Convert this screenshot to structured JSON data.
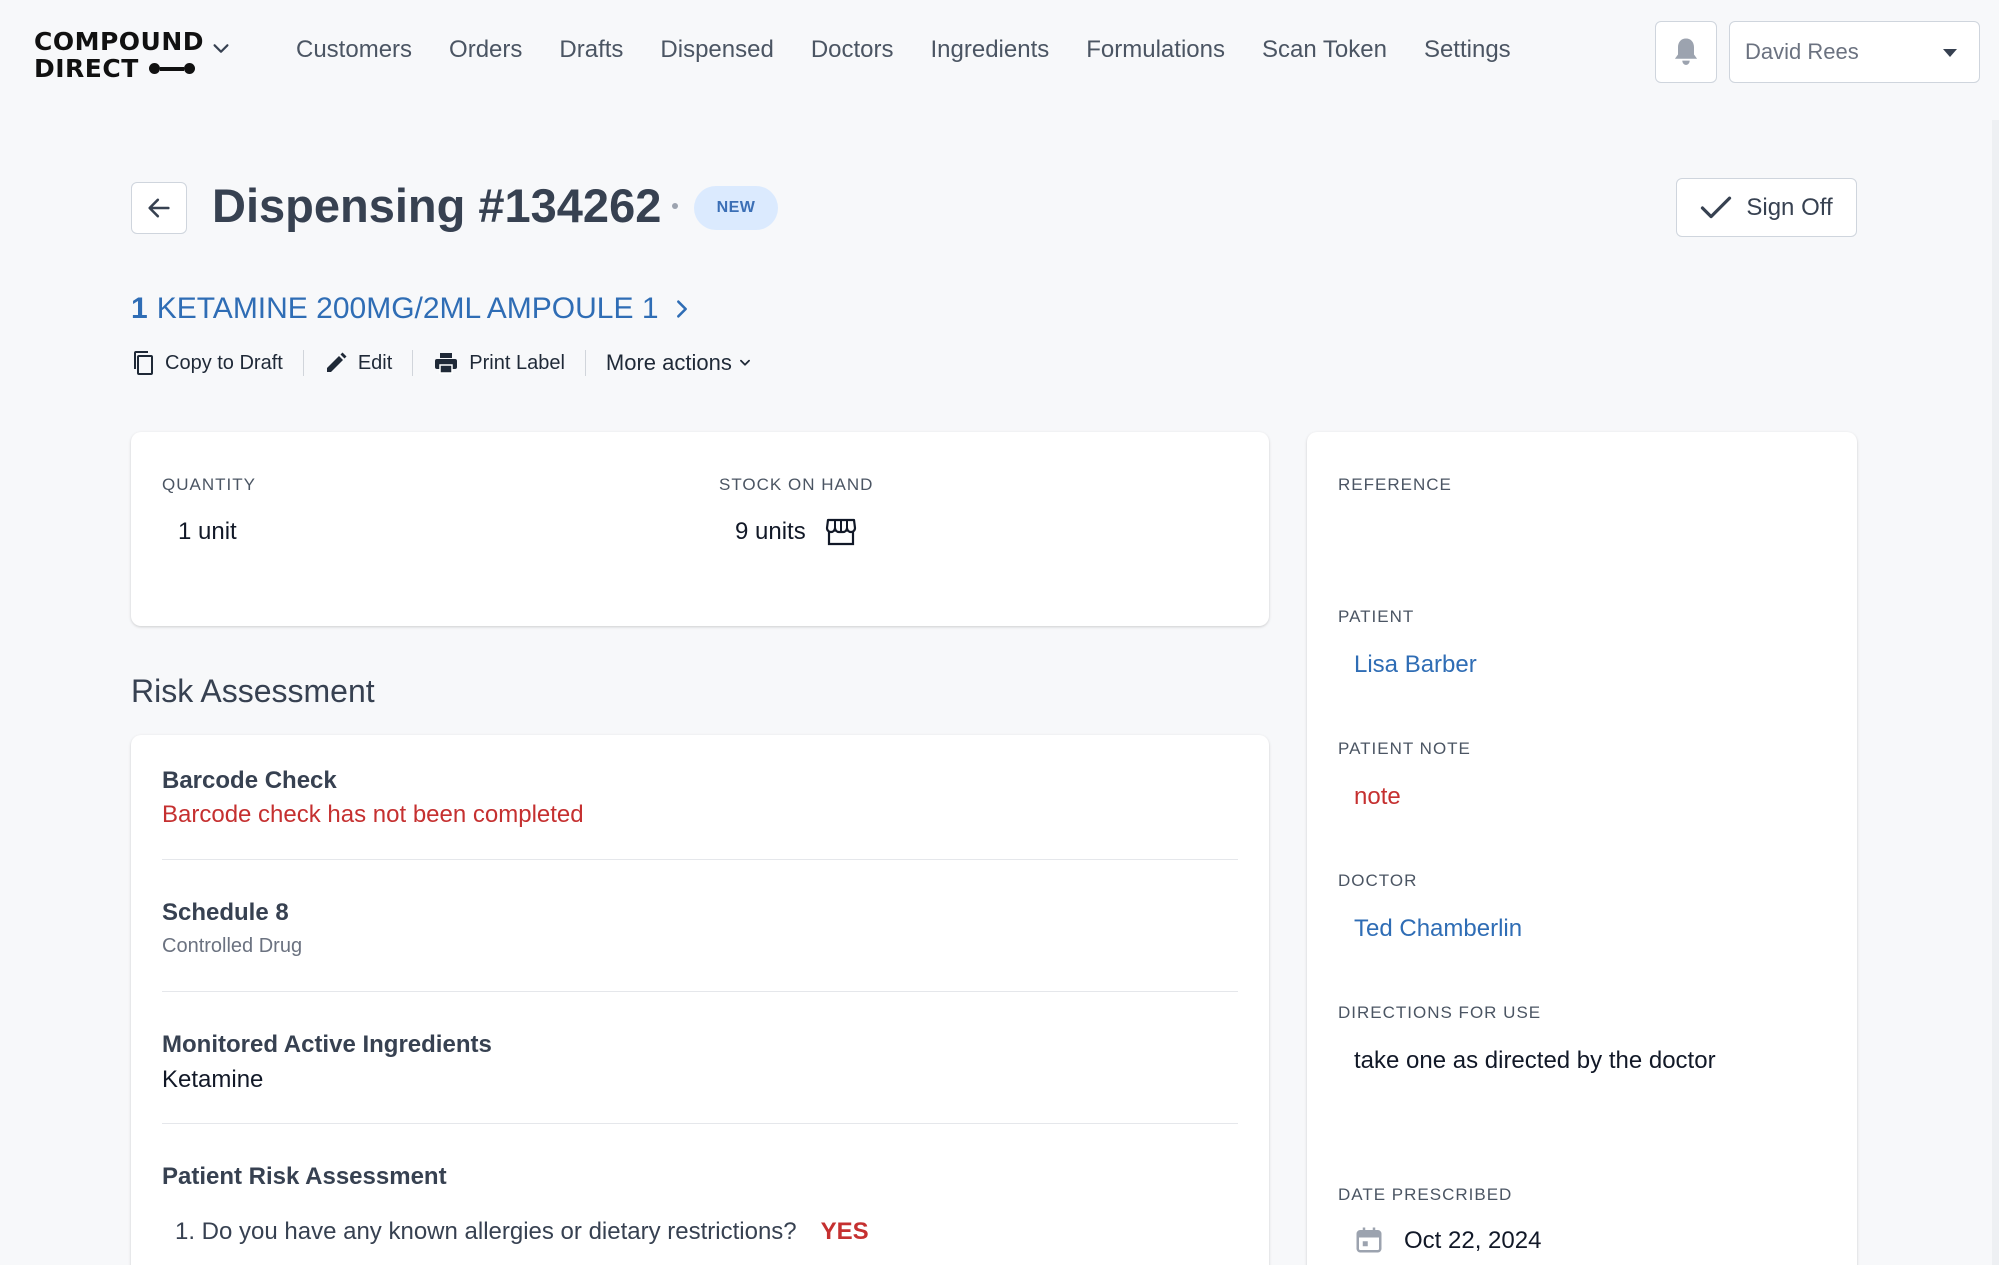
{
  "brand": {
    "line1": "COMPOUND",
    "line2": "DIRECT"
  },
  "nav": {
    "items": [
      "Customers",
      "Orders",
      "Drafts",
      "Dispensed",
      "Doctors",
      "Ingredients",
      "Formulations",
      "Scan Token",
      "Settings"
    ]
  },
  "user": {
    "name": "David Rees"
  },
  "header": {
    "title": "Dispensing #134262",
    "status": "NEW",
    "sign_off_label": "Sign Off"
  },
  "product": {
    "qty": "1",
    "name": "KETAMINE 200MG/2ML AMPOULE 1"
  },
  "actions": {
    "copy_to_draft": "Copy to Draft",
    "edit": "Edit",
    "print_label": "Print Label",
    "more_actions": "More actions"
  },
  "summary": {
    "quantity_label": "QUANTITY",
    "quantity_value": "1 unit",
    "stock_label": "STOCK ON HAND",
    "stock_value": "9 units"
  },
  "risk": {
    "section_title": "Risk Assessment",
    "barcode_title": "Barcode Check",
    "barcode_status": "Barcode check has not been completed",
    "schedule_title": "Schedule 8",
    "schedule_sub": "Controlled Drug",
    "monitored_title": "Monitored Active Ingredients",
    "monitored_value": "Ketamine",
    "patient_title": "Patient Risk Assessment",
    "question_1": "1. Do you have any known allergies or dietary restrictions?",
    "answer_1": "YES"
  },
  "details": {
    "reference_label": "REFERENCE",
    "reference_value": "",
    "patient_label": "PATIENT",
    "patient_value": "Lisa Barber",
    "patient_note_label": "PATIENT NOTE",
    "patient_note_value": "note",
    "doctor_label": "DOCTOR",
    "doctor_value": "Ted Chamberlin",
    "directions_label": "DIRECTIONS FOR USE",
    "directions_value": "take one as directed by the doctor",
    "date_label": "DATE PRESCRIBED",
    "date_value": "Oct 22, 2024"
  },
  "colors": {
    "accent_link": "#2f6db5",
    "danger": "#c53030",
    "badge_bg": "#dbeafe",
    "badge_text": "#3b6fb6"
  }
}
